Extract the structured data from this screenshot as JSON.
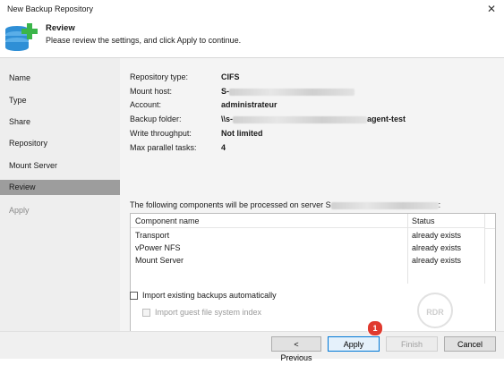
{
  "window": {
    "title": "New Backup Repository",
    "close_glyph": "✕"
  },
  "header": {
    "title": "Review",
    "subtitle": "Please review the settings, and click Apply to continue.",
    "icon": "database-add-icon"
  },
  "sidebar": {
    "items": [
      {
        "label": "Name",
        "state": "normal"
      },
      {
        "label": "Type",
        "state": "normal"
      },
      {
        "label": "Share",
        "state": "normal"
      },
      {
        "label": "Repository",
        "state": "normal"
      },
      {
        "label": "Mount Server",
        "state": "normal"
      },
      {
        "label": "Review",
        "state": "active"
      },
      {
        "label": "Apply",
        "state": "disabled"
      }
    ]
  },
  "summary": {
    "repository_type": {
      "label": "Repository type:",
      "value": "CIFS"
    },
    "mount_host": {
      "label": "Mount host:",
      "value_prefix": "S-"
    },
    "account": {
      "label": "Account:",
      "value": "administrateur"
    },
    "backup_folder": {
      "label": "Backup folder:",
      "value_prefix": "\\\\s-",
      "value_suffix": "agent-test"
    },
    "write_throughput": {
      "label": "Write throughput:",
      "value": "Not limited"
    },
    "max_parallel_tasks": {
      "label": "Max parallel tasks:",
      "value": "4"
    }
  },
  "components": {
    "caption_prefix": "The following components will be processed on server S",
    "caption_suffix": ":",
    "columns": [
      "Component name",
      "Status"
    ],
    "rows": [
      {
        "name": "Transport",
        "status": "already exists"
      },
      {
        "name": "vPower NFS",
        "status": "already exists"
      },
      {
        "name": "Mount Server",
        "status": "already exists"
      }
    ]
  },
  "options": {
    "import_existing": {
      "label": "Import existing backups automatically",
      "checked": false
    },
    "import_guest_index": {
      "label": "Import guest file system index",
      "checked": false,
      "disabled": true
    }
  },
  "buttons": {
    "previous": "< Previous",
    "apply": "Apply",
    "finish": "Finish",
    "cancel": "Cancel"
  },
  "annotation_badge": "1",
  "watermark_text": "RDR",
  "colors": {
    "active_nav": "#9d9d9d",
    "accent": "#0078d7",
    "badge": "#e03a2f",
    "logo_green": "#3bb54a"
  }
}
